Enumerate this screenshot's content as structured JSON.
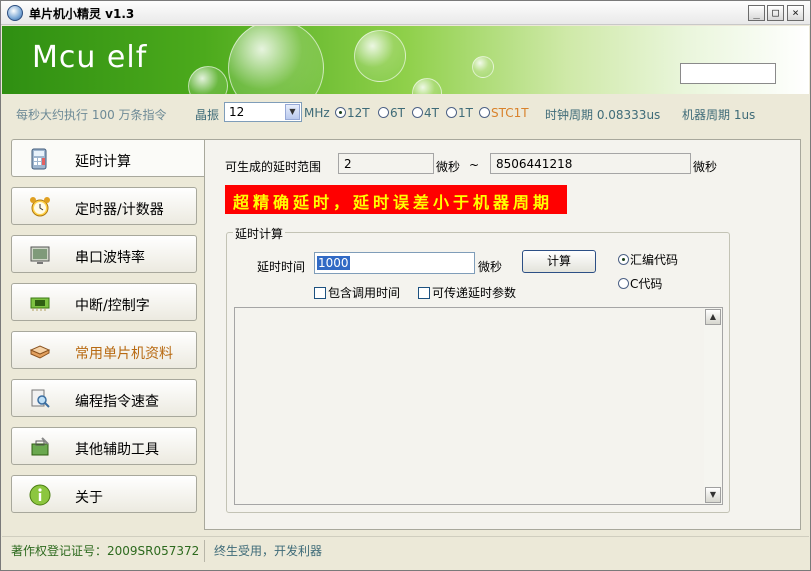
{
  "window": {
    "title": "单片机小精灵  v1.3",
    "controls": {
      "minimize": "_",
      "maximize": "□",
      "close": "×"
    }
  },
  "banner": {
    "logo": "Mcu elf",
    "input_value": ""
  },
  "info": {
    "speed_text": "每秒大约执行 100 万条指令",
    "osc_label": "晶振",
    "osc_value": "12",
    "mhz": "MHz",
    "modes": [
      {
        "label": "12T",
        "selected": true
      },
      {
        "label": "6T",
        "selected": false
      },
      {
        "label": "4T",
        "selected": false
      },
      {
        "label": "1T",
        "selected": false
      },
      {
        "label": "STC1T",
        "selected": false
      }
    ],
    "clock_period": "时钟周期 0.08333us",
    "machine_period": "机器周期 1us"
  },
  "sidebar": {
    "items": [
      {
        "label": "延时计算",
        "icon": "calculator-icon"
      },
      {
        "label": "定时器/计数器",
        "icon": "alarm-clock-icon"
      },
      {
        "label": "串口波特率",
        "icon": "monitor-icon"
      },
      {
        "label": "中断/控制字",
        "icon": "chip-board-icon"
      },
      {
        "label": "常用单片机资料",
        "icon": "book-icon"
      },
      {
        "label": "编程指令速查",
        "icon": "search-document-icon"
      },
      {
        "label": "其他辅助工具",
        "icon": "toolbox-icon"
      },
      {
        "label": "关于",
        "icon": "info-icon"
      }
    ]
  },
  "delay": {
    "range_label": "可生成的延时范围",
    "range_min": "2",
    "unit1": "微秒",
    "tilde": "~",
    "range_max": "8506441218",
    "unit2": "微秒",
    "banner": "超精确延时，延时误差小于机器周期",
    "group_title": "延时计算",
    "delay_time_label": "延时时间",
    "delay_time_value": "1000",
    "delay_unit": "微秒",
    "calc_button": "计算",
    "include_call_label": "包含调用时间",
    "pass_param_label": "可传递延时参数",
    "code_options": [
      {
        "label": "汇编代码",
        "selected": true
      },
      {
        "label": "C代码",
        "selected": false
      }
    ],
    "output_text": ""
  },
  "status": {
    "copyright": "著作权登记证号：2009SR057372",
    "slogan": "终生受用，开发利器"
  },
  "colors": {
    "banner_green": "#4caa1c",
    "highlight_red": "#ff0000",
    "highlight_yellow": "#ffff00",
    "status_green": "#2d6a1e",
    "info_teal": "#3e6b78"
  }
}
